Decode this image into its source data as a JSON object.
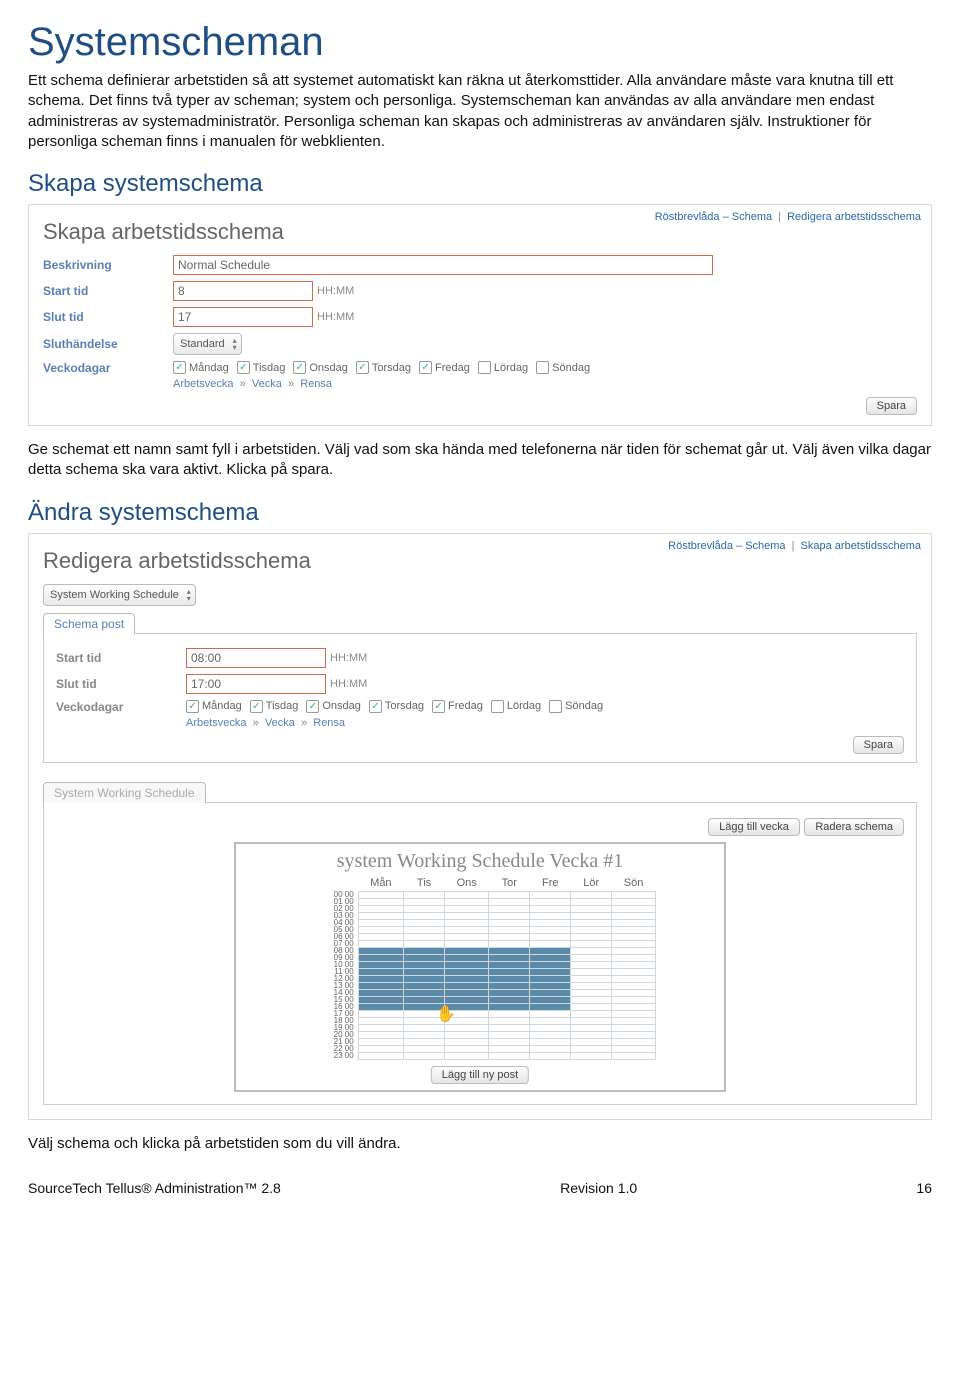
{
  "doc": {
    "h1": "Systemscheman",
    "intro": "Ett schema definierar arbetstiden så att systemet automatiskt kan räkna ut återkomsttider. Alla användare måste vara knutna till ett schema. Det finns två typer av scheman; system och personliga. Systemscheman kan användas av alla användare men endast administreras av systemadministratör. Personliga scheman kan skapas och administreras av användaren själv. Instruktioner för personliga scheman finns i manualen för webklienten.",
    "h2a": "Skapa systemschema",
    "para_a": "Ge schemat ett namn samt fyll i arbetstiden. Välj vad som ska hända med telefonerna när tiden för schemat går ut. Välj även vilka dagar detta schema ska vara aktivt. Klicka på spara.",
    "h2b": "Ändra systemschema",
    "para_b": "Välj schema och klicka på arbetstiden som du vill ändra.",
    "footer_left": "SourceTech Tellus® Administration™ 2.8",
    "footer_mid": "Revision 1.0",
    "footer_right": "16"
  },
  "labels": {
    "beskrivning": "Beskrivning",
    "start_tid": "Start tid",
    "slut_tid": "Slut tid",
    "sluthandelse": "Sluthändelse",
    "veckodagar": "Veckodagar",
    "hhmm": "HH:MM",
    "arbetsvecka": "Arbetsvecka",
    "vecka": "Vecka",
    "rensa": "Rensa",
    "sep": "»"
  },
  "days": [
    "Måndag",
    "Tisdag",
    "Onsdag",
    "Torsdag",
    "Fredag",
    "Lördag",
    "Söndag"
  ],
  "days_short": [
    "Mån",
    "Tis",
    "Ons",
    "Tor",
    "Fre",
    "Lör",
    "Sön"
  ],
  "shot1": {
    "title": "Skapa arbetstidsschema",
    "breadcrumb": [
      "Röstbrevlåda – Schema",
      "Redigera arbetstidsschema"
    ],
    "beskrivning_value": "Normal Schedule",
    "start_value": "8",
    "slut_value": "17",
    "select_value": "Standard",
    "checked": [
      true,
      true,
      true,
      true,
      true,
      false,
      false
    ],
    "save": "Spara"
  },
  "shot2": {
    "title": "Redigera arbetstidsschema",
    "breadcrumb": [
      "Röstbrevlåda – Schema",
      "Skapa arbetstidsschema"
    ],
    "select_value": "System Working Schedule",
    "tab": "Schema post",
    "start_value": "08:00",
    "slut_value": "17:00",
    "checked": [
      true,
      true,
      true,
      true,
      true,
      false,
      false
    ],
    "save": "Spara",
    "tab2": "System Working Schedule",
    "btn_add_week": "Lägg till vecka",
    "btn_delete": "Radera schema",
    "chart_title": "system Working Schedule Vecka #1",
    "btn_add_post": "Lägg till ny post"
  },
  "chart_data": {
    "type": "heatmap",
    "title": "System Working Schedule Vecka #1",
    "xlabel": "",
    "ylabel": "",
    "x": [
      "Mån",
      "Tis",
      "Ons",
      "Tor",
      "Fre",
      "Lör",
      "Sön"
    ],
    "y_hours": [
      0,
      1,
      2,
      3,
      4,
      5,
      6,
      7,
      8,
      9,
      10,
      11,
      12,
      13,
      14,
      15,
      16,
      17,
      18,
      19,
      20,
      21,
      22,
      23
    ],
    "filled_range": {
      "start_hour": 8,
      "end_hour": 17,
      "days_active": [
        "Mån",
        "Tis",
        "Ons",
        "Tor",
        "Fre"
      ]
    },
    "series": [
      {
        "name": "Mån",
        "values": [
          0,
          0,
          0,
          0,
          0,
          0,
          0,
          0,
          1,
          1,
          1,
          1,
          1,
          1,
          1,
          1,
          1,
          0,
          0,
          0,
          0,
          0,
          0,
          0
        ]
      },
      {
        "name": "Tis",
        "values": [
          0,
          0,
          0,
          0,
          0,
          0,
          0,
          0,
          1,
          1,
          1,
          1,
          1,
          1,
          1,
          1,
          1,
          0,
          0,
          0,
          0,
          0,
          0,
          0
        ]
      },
      {
        "name": "Ons",
        "values": [
          0,
          0,
          0,
          0,
          0,
          0,
          0,
          0,
          1,
          1,
          1,
          1,
          1,
          1,
          1,
          1,
          1,
          0,
          0,
          0,
          0,
          0,
          0,
          0
        ]
      },
      {
        "name": "Tor",
        "values": [
          0,
          0,
          0,
          0,
          0,
          0,
          0,
          0,
          1,
          1,
          1,
          1,
          1,
          1,
          1,
          1,
          1,
          0,
          0,
          0,
          0,
          0,
          0,
          0
        ]
      },
      {
        "name": "Fre",
        "values": [
          0,
          0,
          0,
          0,
          0,
          0,
          0,
          0,
          1,
          1,
          1,
          1,
          1,
          1,
          1,
          1,
          1,
          0,
          0,
          0,
          0,
          0,
          0,
          0
        ]
      },
      {
        "name": "Lör",
        "values": [
          0,
          0,
          0,
          0,
          0,
          0,
          0,
          0,
          0,
          0,
          0,
          0,
          0,
          0,
          0,
          0,
          0,
          0,
          0,
          0,
          0,
          0,
          0,
          0
        ]
      },
      {
        "name": "Sön",
        "values": [
          0,
          0,
          0,
          0,
          0,
          0,
          0,
          0,
          0,
          0,
          0,
          0,
          0,
          0,
          0,
          0,
          0,
          0,
          0,
          0,
          0,
          0,
          0,
          0
        ]
      }
    ]
  }
}
